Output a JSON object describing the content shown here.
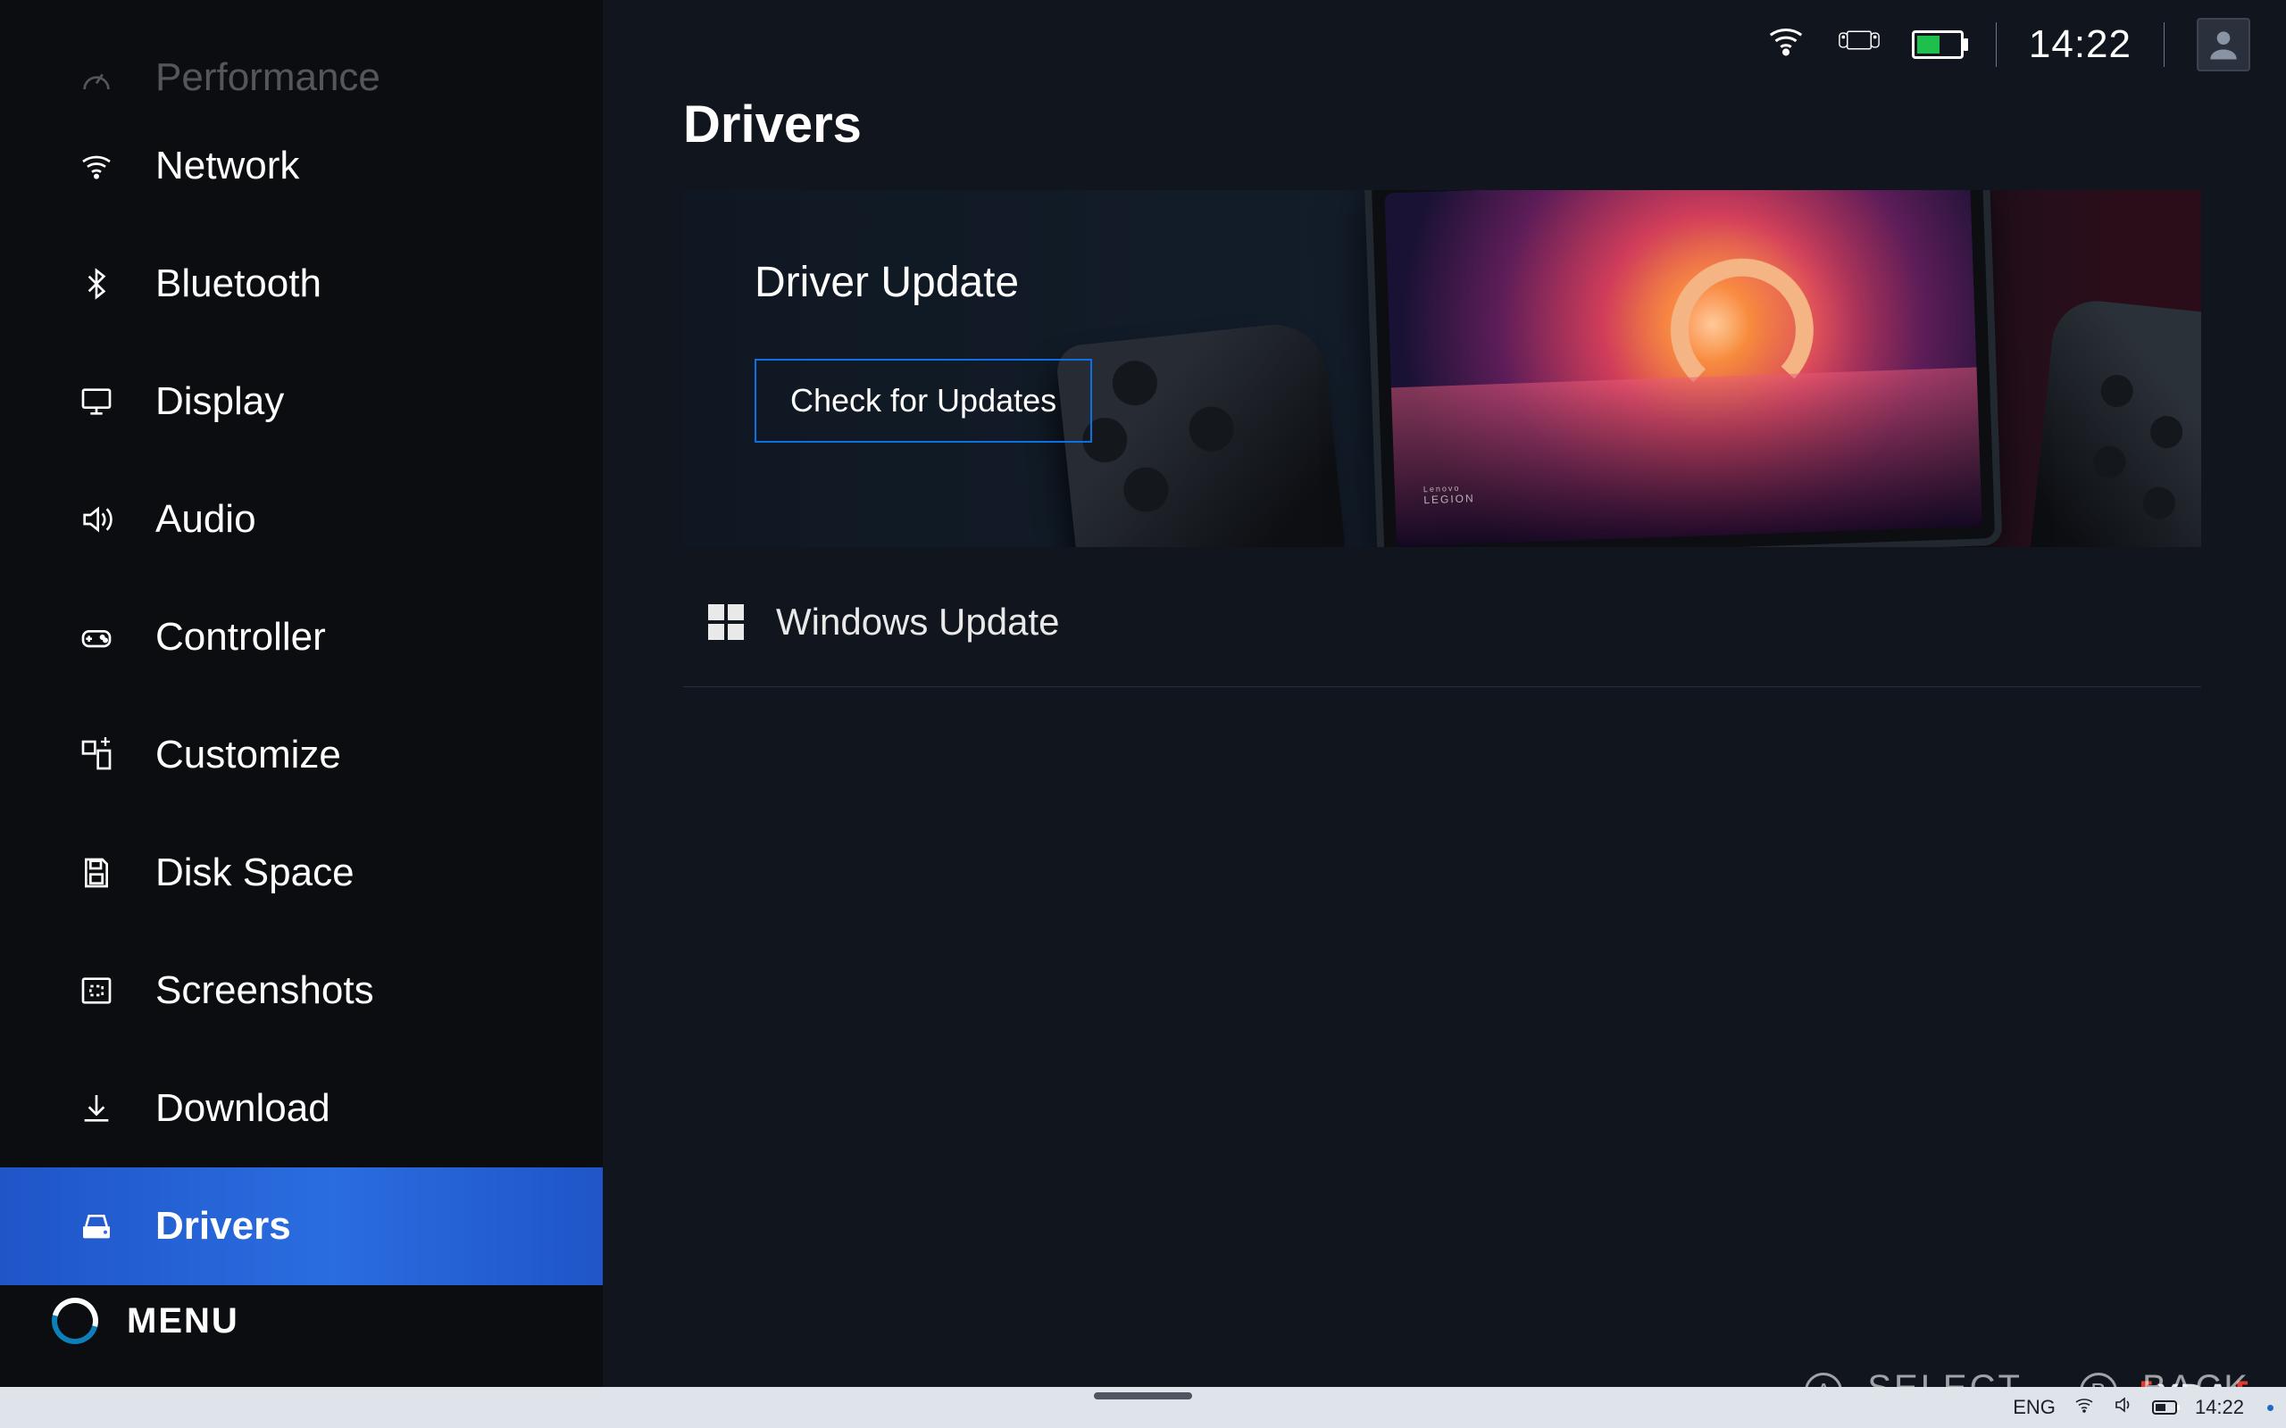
{
  "sidebar": {
    "items": [
      {
        "id": "performance",
        "label": "Performance"
      },
      {
        "id": "network",
        "label": "Network"
      },
      {
        "id": "bluetooth",
        "label": "Bluetooth"
      },
      {
        "id": "display",
        "label": "Display"
      },
      {
        "id": "audio",
        "label": "Audio"
      },
      {
        "id": "controller",
        "label": "Controller"
      },
      {
        "id": "customize",
        "label": "Customize"
      },
      {
        "id": "diskspace",
        "label": "Disk Space"
      },
      {
        "id": "screenshots",
        "label": "Screenshots"
      },
      {
        "id": "download",
        "label": "Download"
      },
      {
        "id": "drivers",
        "label": "Drivers"
      }
    ],
    "selected": "drivers",
    "menu_label": "MENU"
  },
  "page": {
    "title": "Drivers",
    "driver_card_title": "Driver Update",
    "check_updates_label": "Check for Updates",
    "windows_update_label": "Windows Update",
    "device_brand": "LEGION",
    "device_brand_pre": "Lenovo"
  },
  "statusbar": {
    "time": "14:22"
  },
  "footer": {
    "select_key": "A",
    "select_label": "SELECT",
    "back_key": "B",
    "back_label": "BACK"
  },
  "taskbar": {
    "lang": "ENG",
    "time": "14:22"
  },
  "watermark": {
    "text": "XDA"
  }
}
